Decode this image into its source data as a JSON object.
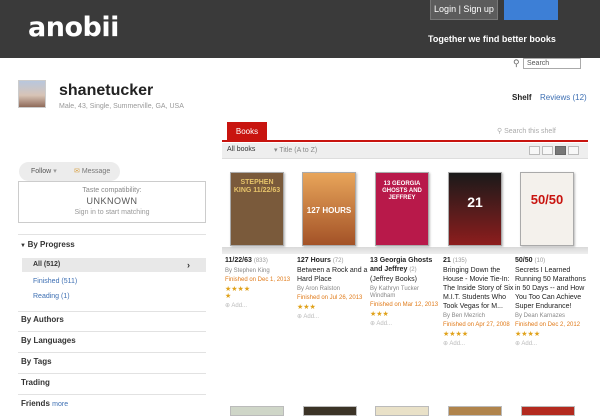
{
  "header": {
    "logo": "anobii",
    "login_label": "Login | Sign up",
    "tagline": "Together we find better books",
    "search_placeholder": "Search"
  },
  "profile": {
    "username": "shanetucker",
    "meta": "Male, 43, Single, Summerville, GA, USA",
    "tabs": {
      "shelf": "Shelf",
      "reviews": "Reviews (12)"
    }
  },
  "sidebar": {
    "follow_label": "Follow",
    "message_label": "Message",
    "taste": {
      "label": "Taste compatibility:",
      "value": "UNKNOWN",
      "link": "Sign in to start matching"
    },
    "progress_header": "By Progress",
    "progress_items": [
      {
        "label": "All (512)",
        "selected": true
      },
      {
        "label": "Finished (511)",
        "selected": false
      },
      {
        "label": "Reading (1)",
        "selected": false
      }
    ],
    "sections": [
      "By Authors",
      "By Languages",
      "By Tags",
      "Trading"
    ],
    "friends_label": "Friends",
    "friends_more": "more"
  },
  "shelf": {
    "tab_label": "Books",
    "search_placeholder": "Search this shelf",
    "filter_label": "All books",
    "sort_label": "Title (A to Z)",
    "books": [
      {
        "title": "11/22/63",
        "count": "(833)",
        "author": "By Stephen King",
        "finished": "Finished on Dec 1, 2013",
        "stars": "★★★★\n★",
        "add": "Add...",
        "cover_color": "#7a5a3b",
        "cover_text": "STEPHEN KING 11/22/63"
      },
      {
        "title": "127 Hours",
        "count": "(72)",
        "subtitle": "Between a Rock and a Hard Place",
        "author": "By Aron Ralston",
        "finished": "Finished on Jul 26, 2013",
        "stars": "★★★",
        "add": "Add...",
        "cover_color": "#c57a3e",
        "cover_text": "127 HOURS"
      },
      {
        "title": "13 Georgia Ghosts and Jeffrey",
        "count": "(2)",
        "subtitle": "(Jeffrey Books)",
        "author": "By Kathryn Tucker Windham",
        "finished": "Finished on Mar 12, 2013",
        "stars": "★★★",
        "add": "Add...",
        "cover_color": "#b8194a",
        "cover_text": "13 GEORGIA GHOSTS AND JEFFREY"
      },
      {
        "title": "21",
        "count": "(135)",
        "subtitle": "Bringing Down the House - Movie Tie-In: The Inside Story of Six M.I.T. Students Who Took Vegas for M...",
        "author": "By Ben Mezrich",
        "finished": "Finished on Apr 27, 2008",
        "stars": "★★★★",
        "add": "Add...",
        "cover_color": "#8d1d1d",
        "cover_text": "21"
      },
      {
        "title": "50/50",
        "count": "(10)",
        "subtitle": "Secrets I Learned Running 50 Marathons in 50 Days -- and How You Too Can Achieve Super Endurance!",
        "author": "By Dean Karnazes",
        "finished": "Finished on Dec 2, 2012",
        "stars": "★★★★",
        "add": "Add...",
        "cover_color": "#f4f1ec",
        "cover_text": "50/50"
      }
    ]
  },
  "colors": {
    "accent_red": "#c8140f",
    "link_blue": "#3d6fb3",
    "header_dark": "#3a3a3a",
    "finished_orange": "#e07a18"
  }
}
